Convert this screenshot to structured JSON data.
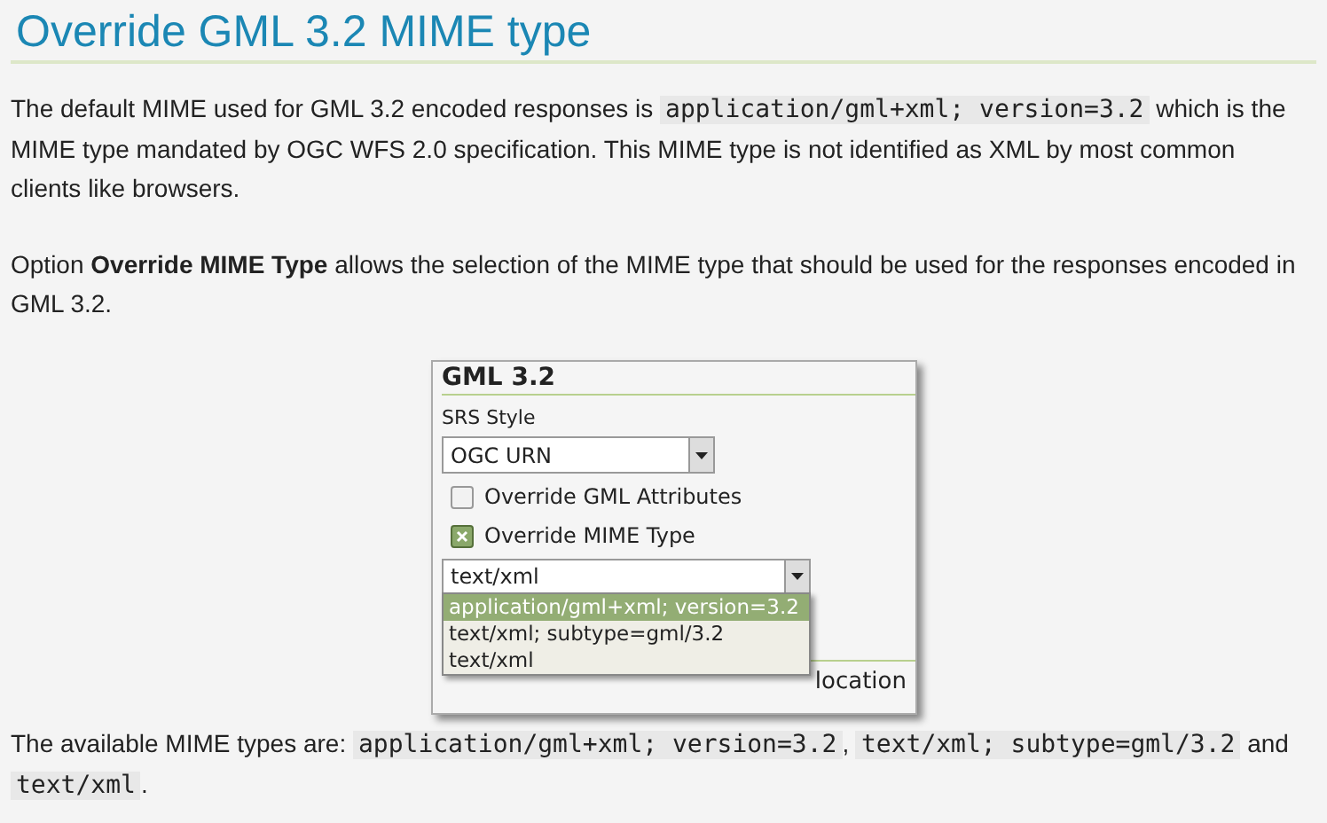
{
  "heading": "Override GML 3.2 MIME type",
  "paragraphs": [
    [
      {
        "kind": "text",
        "text": "The default MIME used for GML 3.2 encoded responses is "
      },
      {
        "kind": "code",
        "text": "application/gml+xml; version=3.2"
      },
      {
        "kind": "text",
        "text": " which is the MIME type mandated by OGC WFS 2.0 specification. This MIME type is not identified as XML by most common clients like browsers."
      }
    ],
    [
      {
        "kind": "text",
        "text": "Option "
      },
      {
        "kind": "bold",
        "text": "Override MIME Type"
      },
      {
        "kind": "text",
        "text": " allows the selection of the MIME type that should be used for the responses encoded in GML 3.2."
      }
    ]
  ],
  "panel": {
    "title": "GML 3.2",
    "srs_label": "SRS Style",
    "srs_value": "OGC URN",
    "checkboxes": [
      {
        "label": "Override GML Attributes",
        "checked": false
      },
      {
        "label": "Override MIME Type",
        "checked": true
      }
    ],
    "mime_value": "text/xml",
    "options": [
      {
        "label": "application/gml+xml; version=3.2",
        "selected": true
      },
      {
        "label": "text/xml; subtype=gml/3.2",
        "selected": false
      },
      {
        "label": "text/xml",
        "selected": false
      }
    ],
    "hidden_row_label": "location"
  },
  "footer": [
    {
      "kind": "text",
      "text": "The available MIME types are: "
    },
    {
      "kind": "code",
      "text": "application/gml+xml; version=3.2"
    },
    {
      "kind": "text",
      "text": ", "
    },
    {
      "kind": "code",
      "text": "text/xml; subtype=gml/3.2"
    },
    {
      "kind": "text",
      "text": " and "
    },
    {
      "kind": "code",
      "text": "text/xml"
    },
    {
      "kind": "text",
      "text": "."
    }
  ]
}
